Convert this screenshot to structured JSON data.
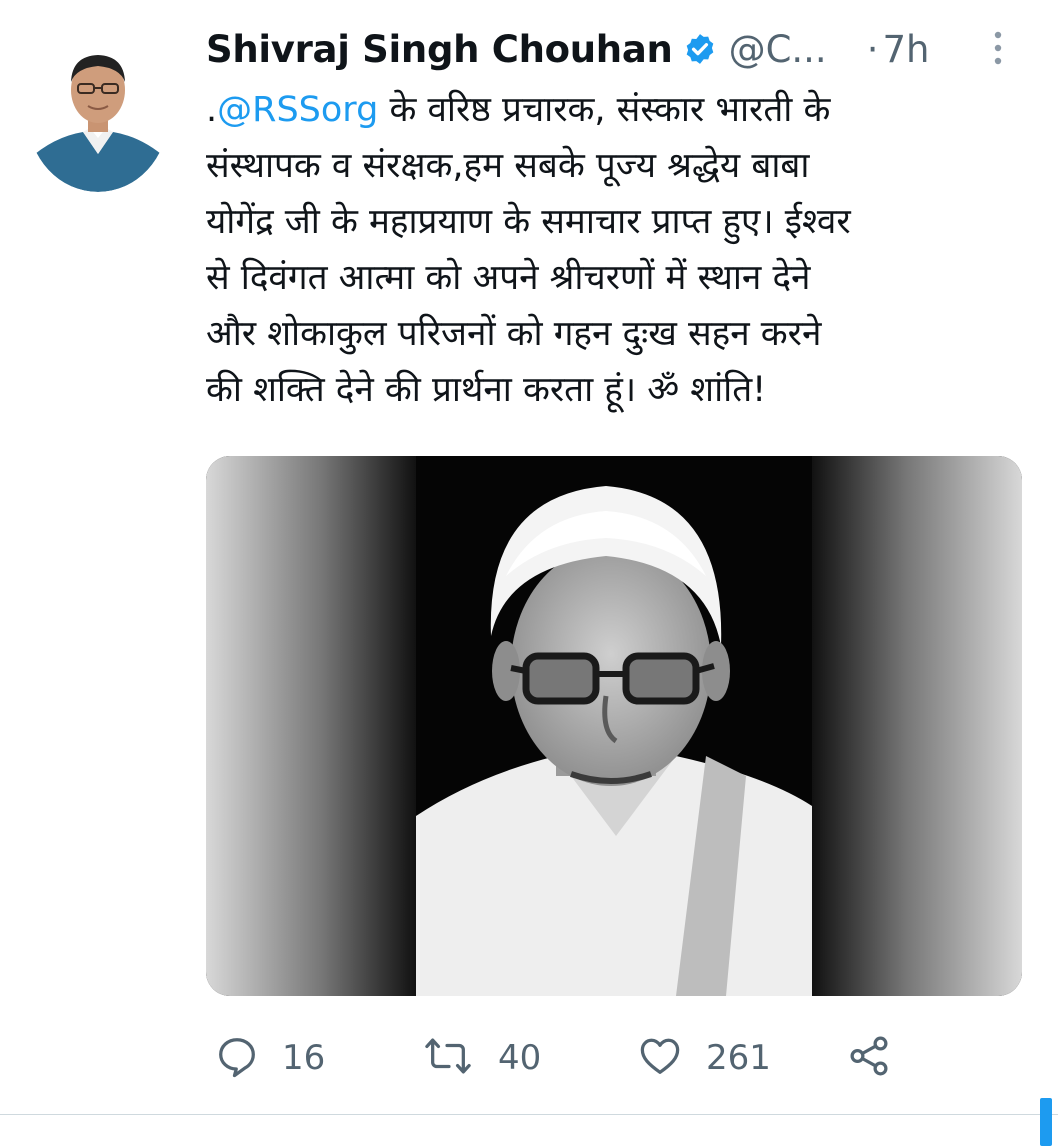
{
  "tweet": {
    "author_name": "Shivraj Singh Chouhan",
    "handle": "@C...",
    "separator": "·",
    "time": "7h",
    "text_prefix": ".",
    "mention": "@RSSorg",
    "line1_rest": " के वरिष्ठ प्रचारक, संस्कार भारती के",
    "line2": "संस्थापक व संरक्षक,हम सबके पूज्य श्रद्धेय बाबा",
    "line3": "योगेंद्र जी के महाप्रयाण के समाचार प्राप्त हुए। ईश्वर",
    "line4": "से दिवंगत आत्मा को अपने श्रीचरणों में स्थान देने",
    "line5": "और शोकाकुल परिजनों को गहन दुःख सहन करने",
    "line6": "की शक्ति देने की प्रार्थना करता हूं। ॐ शांति!"
  },
  "actions": {
    "reply_count": "16",
    "retweet_count": "40",
    "like_count": "261"
  },
  "icons": {
    "verified": "verified-badge-icon",
    "more": "more-vertical-icon",
    "reply": "reply-icon",
    "retweet": "retweet-icon",
    "like": "heart-icon",
    "share": "share-icon"
  },
  "colors": {
    "accent": "#1d9bf0",
    "secondary_text": "#536471",
    "primary_text": "#0f1419"
  }
}
